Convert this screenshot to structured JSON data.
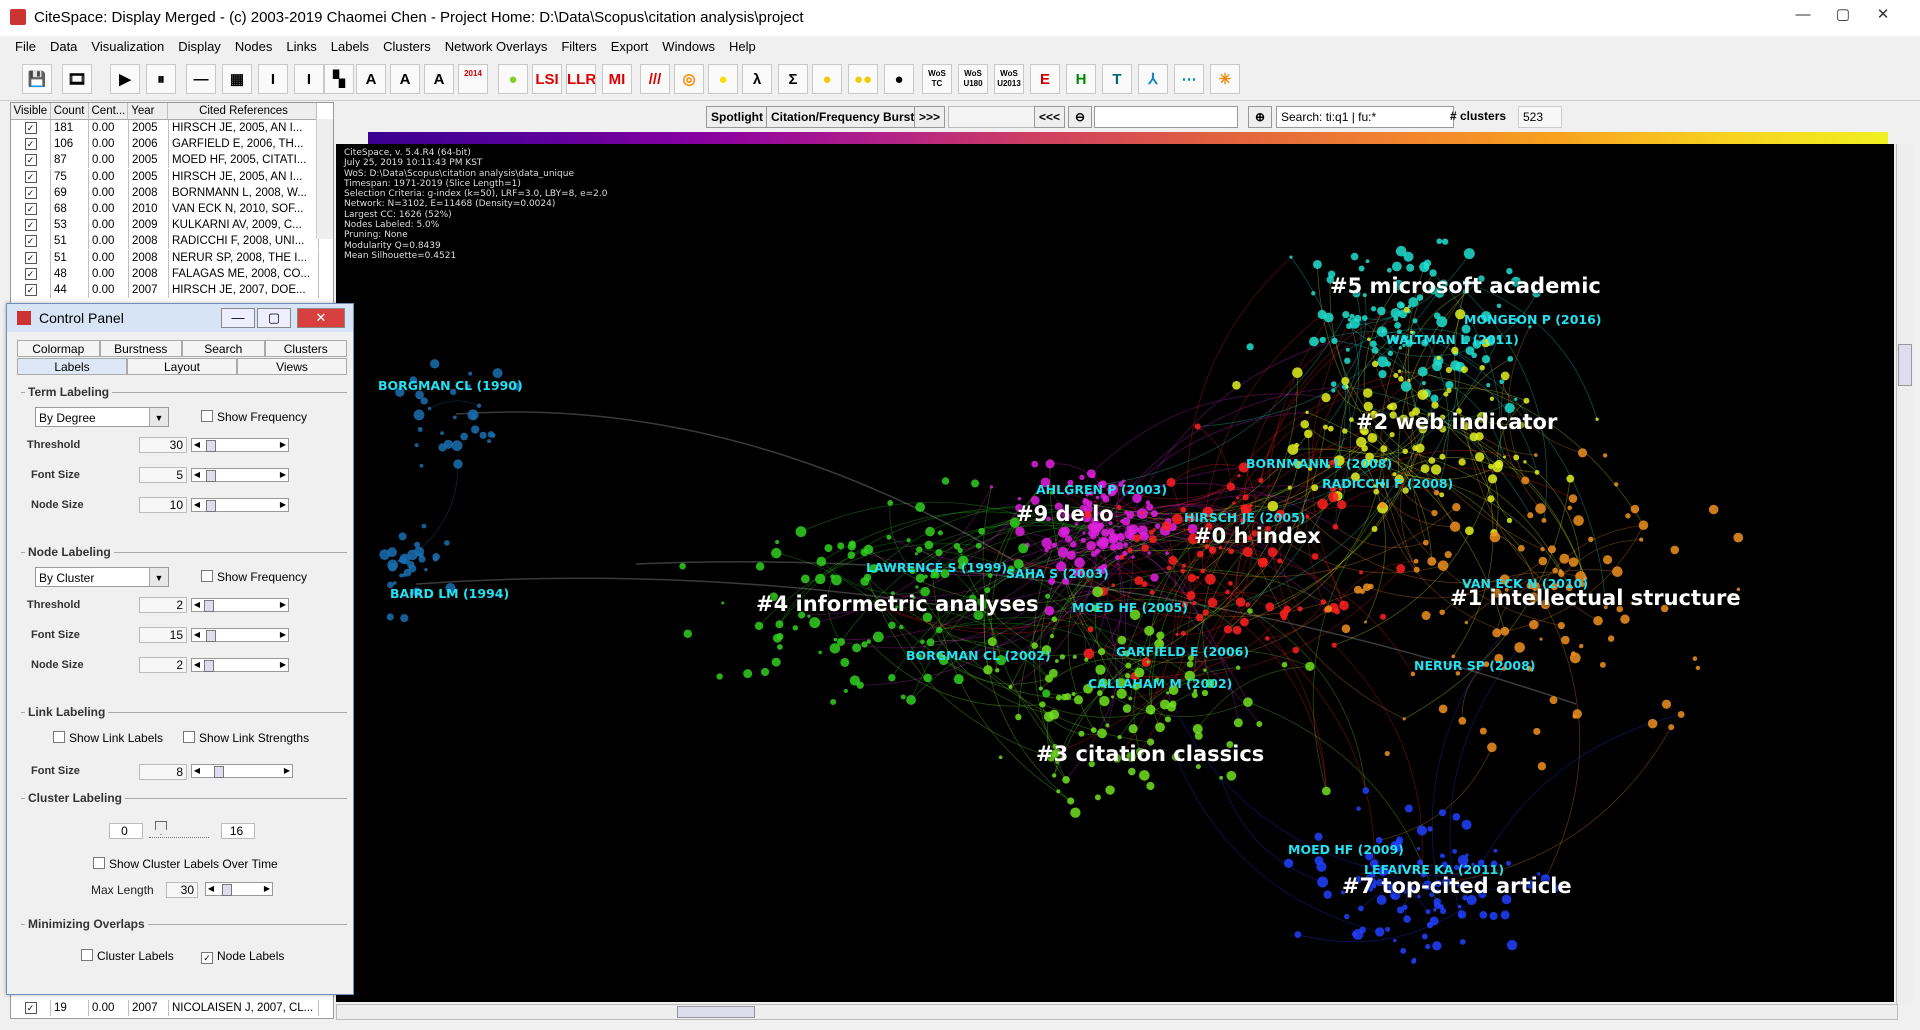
{
  "window": {
    "title": "CiteSpace: Display Merged - (c) 2003-2019 Chaomei Chen - Project Home: D:\\Data\\Scopus\\citation analysis\\project",
    "minimize": "—",
    "maximize": "▢",
    "close": "✕"
  },
  "menu": [
    "File",
    "Data",
    "Visualization",
    "Display",
    "Nodes",
    "Links",
    "Labels",
    "Clusters",
    "Network Overlays",
    "Filters",
    "Export",
    "Windows",
    "Help"
  ],
  "toolbar": [
    {
      "name": "save-icon",
      "label": "💾"
    },
    {
      "name": "film-icon",
      "label": "🎞"
    },
    {
      "name": "play-icon",
      "label": "▶"
    },
    {
      "name": "pause-icon",
      "label": "⏸"
    },
    {
      "name": "line-icon",
      "label": "—"
    },
    {
      "name": "grid-icon",
      "label": "▦"
    },
    {
      "name": "i-beam-icon",
      "label": "I"
    },
    {
      "name": "i-beam-alt-icon",
      "label": "I"
    },
    {
      "name": "merge-icon",
      "label": "▚"
    },
    {
      "name": "triangle-a-icon",
      "label": "A"
    },
    {
      "name": "triangle-b-icon",
      "label": "A"
    },
    {
      "name": "triangle-c-icon",
      "label": "A"
    },
    {
      "name": "years-icon",
      "label": "2014"
    },
    {
      "name": "circle-icon",
      "label": "●"
    },
    {
      "name": "lsi-button",
      "label": "LSI"
    },
    {
      "name": "llr-button",
      "label": "LLR"
    },
    {
      "name": "mi-button",
      "label": "MI"
    },
    {
      "name": "slash-icon",
      "label": "///"
    },
    {
      "name": "target-icon",
      "label": "◎"
    },
    {
      "name": "blob-icon",
      "label": "●"
    },
    {
      "name": "lambda-icon",
      "label": "λ"
    },
    {
      "name": "sigma-icon",
      "label": "Σ"
    },
    {
      "name": "bubble-icon",
      "label": "●"
    },
    {
      "name": "bubbles-icon",
      "label": "●●"
    },
    {
      "name": "rgb-icon",
      "label": "●"
    },
    {
      "name": "wos-tc-button",
      "label": "WoS TC"
    },
    {
      "name": "wos-u180-button",
      "label": "WoS U180"
    },
    {
      "name": "wos-u2013-button",
      "label": "WoS U2013"
    },
    {
      "name": "e-icon",
      "label": "E"
    },
    {
      "name": "h-icon",
      "label": "H"
    },
    {
      "name": "t-icon",
      "label": "T"
    },
    {
      "name": "tree-icon",
      "label": "⅄"
    },
    {
      "name": "network-icon",
      "label": "⋯"
    },
    {
      "name": "burst-icon",
      "label": "✳"
    }
  ],
  "table": {
    "headers": [
      "Visible",
      "Count",
      "Cent...",
      "Year",
      "Cited References"
    ],
    "rows": [
      [
        "✓",
        "181",
        "0.00",
        "2005",
        "HIRSCH JE, 2005, AN I..."
      ],
      [
        "✓",
        "106",
        "0.00",
        "2006",
        "GARFIELD E, 2006, TH..."
      ],
      [
        "✓",
        "87",
        "0.00",
        "2005",
        "MOED HF, 2005, CITATI..."
      ],
      [
        "✓",
        "75",
        "0.00",
        "2005",
        "HIRSCH JE, 2005, AN I..."
      ],
      [
        "✓",
        "69",
        "0.00",
        "2008",
        "BORNMANN L, 2008, W..."
      ],
      [
        "✓",
        "68",
        "0.00",
        "2010",
        "VAN ECK N, 2010, SOF..."
      ],
      [
        "✓",
        "53",
        "0.00",
        "2009",
        "KULKARNI AV, 2009, C..."
      ],
      [
        "✓",
        "51",
        "0.00",
        "2008",
        "RADICCHI F, 2008, UNI..."
      ],
      [
        "✓",
        "51",
        "0.00",
        "2008",
        "NERUR SP, 2008, THE I..."
      ],
      [
        "✓",
        "48",
        "0.00",
        "2008",
        "FALAGAS ME, 2008, CO..."
      ],
      [
        "✓",
        "44",
        "0.00",
        "2007",
        "HIRSCH JE, 2007, DOE..."
      ]
    ],
    "last_row": [
      "✓",
      "19",
      "0.00",
      "2007",
      "NICOLAISEN J, 2007, CL..."
    ]
  },
  "control_panel": {
    "title": "Control Panel",
    "tabs_row1": [
      "Colormap",
      "Burstness",
      "Search",
      "Clusters"
    ],
    "tabs_row2": [
      "Labels",
      "Layout",
      "Views"
    ],
    "term_labeling": {
      "title": "Term Labeling",
      "method": "By Degree",
      "show_frequency": "Show Frequency",
      "threshold_label": "Threshold",
      "threshold": "30",
      "font_size_label": "Font Size",
      "font_size": "5",
      "node_size_label": "Node Size",
      "node_size": "10"
    },
    "node_labeling": {
      "title": "Node Labeling",
      "method": "By Cluster",
      "show_frequency": "Show Frequency",
      "threshold_label": "Threshold",
      "threshold": "2",
      "font_size_label": "Font Size",
      "font_size": "15",
      "node_size_label": "Node Size",
      "node_size": "2"
    },
    "link_labeling": {
      "title": "Link Labeling",
      "show_link_labels": "Show Link Labels",
      "show_link_strengths": "Show Link Strengths",
      "font_size_label": "Font Size",
      "font_size": "8"
    },
    "cluster_labeling": {
      "title": "Cluster Labeling",
      "min": "0",
      "max": "16",
      "over_time": "Show Cluster Labels Over Time",
      "max_length_label": "Max Length",
      "max_length": "30"
    },
    "minimizing": {
      "title": "Minimizing Overlaps",
      "cluster_labels": "Cluster Labels",
      "node_labels": "Node Labels",
      "node_labels_checked": "✓"
    }
  },
  "controls": {
    "spotlight": "Spotlight",
    "burst": "Citation/Frequency Burst",
    "next": ">>>",
    "prev": "<<<",
    "search_value": "Search: ti:q1 | fu:*",
    "clusters_label": "# clusters",
    "clusters_value": "523"
  },
  "info_text": "CiteSpace, v. 5.4.R4 (64-bit)\nJuly 25, 2019 10:11:43 PM KST\nWoS: D:\\Data\\Scopus\\citation analysis\\data_unique\nTimespan: 1971-2019 (Slice Length=1)\nSelection Criteria: g-index (k=50), LRF=3.0, LBY=8, e=2.0\nNetwork: N=3102, E=11468 (Density=0.0024)\nLargest CC: 1626 (52%)\nNodes Labeled: 5.0%\nPruning: None\nModularity Q=0.8439\nMean Silhouette=0.4521",
  "clusters": [
    {
      "label": "#5 microsoft academic",
      "color": "#20e0d0"
    },
    {
      "label": "#2 web indicator",
      "color": "#e0f020"
    },
    {
      "label": "#9 de lo",
      "color": "#e020e0"
    },
    {
      "label": "#0 h index",
      "color": "#ff2020"
    },
    {
      "label": "#4 informetric analyses",
      "color": "#30d020"
    },
    {
      "label": "#1 intellectual structure",
      "color": "#f09020"
    },
    {
      "label": "#3 citation classics",
      "color": "#70e020"
    },
    {
      "label": "#7 top-cited article",
      "color": "#2040ff"
    }
  ],
  "node_labels": [
    "BORGMAN CL (1990)",
    "BAIRD LM (1994)",
    "MONGEON P (2016)",
    "WALTMAN L (2011)",
    "BORNMANN L (2008)",
    "RADICCHI F (2008)",
    "AHLGREN P (2003)",
    "HIRSCH JE (2005)",
    "LAWRENCE S (1999)",
    "SAHA S (2003)",
    "MOED HF (2005)",
    "VAN ECK N (2010)",
    "GARFIELD E (2006)",
    "BORGMAN CL (2002)",
    "NERUR SP (2008)",
    "CALLAHAM M (2002)",
    "MOED HF (2009)",
    "LEFAIVRE KA (2011)"
  ]
}
